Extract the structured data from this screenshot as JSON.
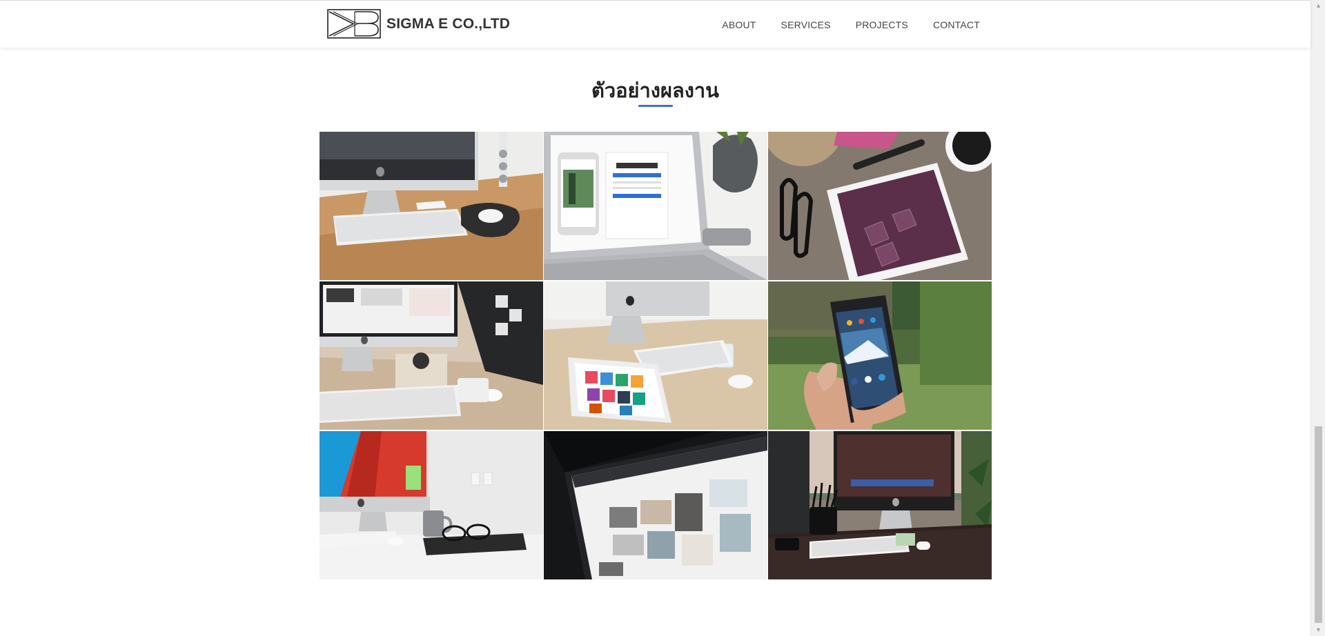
{
  "header": {
    "brand_name": "SIGMA E CO.,LTD",
    "nav": [
      {
        "label": "ABOUT"
      },
      {
        "label": "SERVICES"
      },
      {
        "label": "PROJECTS"
      },
      {
        "label": "CONTACT"
      }
    ]
  },
  "portfolio": {
    "title": "ตัวอย่างผลงาน",
    "accent_color": "#3d6fd6",
    "images": [
      {
        "name": "imac-keyboard-desk"
      },
      {
        "name": "laptop-phone-instagram"
      },
      {
        "name": "tablet-glasses-pen"
      },
      {
        "name": "imac-notebook-workspace"
      },
      {
        "name": "imac-tablet-apps"
      },
      {
        "name": "hand-holding-phone"
      },
      {
        "name": "imac-mug-glasses"
      },
      {
        "name": "monitor-web-design"
      },
      {
        "name": "imac-window-office"
      }
    ]
  },
  "scrollbar": {
    "up_icon": "triangle-up-icon",
    "down_icon": "triangle-down-icon"
  }
}
